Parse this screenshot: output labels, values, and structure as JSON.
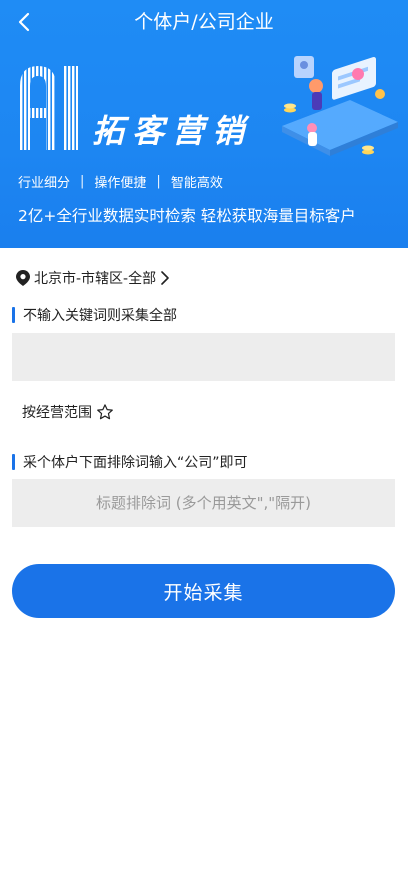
{
  "header": {
    "title": "个体户/公司企业"
  },
  "banner": {
    "logo_text": "AI",
    "headline": "拓客营销",
    "features": [
      "行业细分",
      "操作便捷",
      "智能高效"
    ],
    "separator": "|",
    "tagline": "2亿+全行业数据实时检索  轻松获取海量目标客户"
  },
  "location": {
    "text": "北京市-市辖区-全部"
  },
  "keyword": {
    "label": "不输入关键词则采集全部",
    "value": "",
    "placeholder": ""
  },
  "scope": {
    "label": "按经营范围"
  },
  "exclude": {
    "label": "采个体户下面排除词输入“公司”即可",
    "value": "",
    "placeholder": "标题排除词 (多个用英文\",\"隔开)"
  },
  "action": {
    "label": "开始采集"
  },
  "colors": {
    "brand": "#1a73e8",
    "banner": "#1d86f2",
    "input_bg": "#ededed"
  }
}
